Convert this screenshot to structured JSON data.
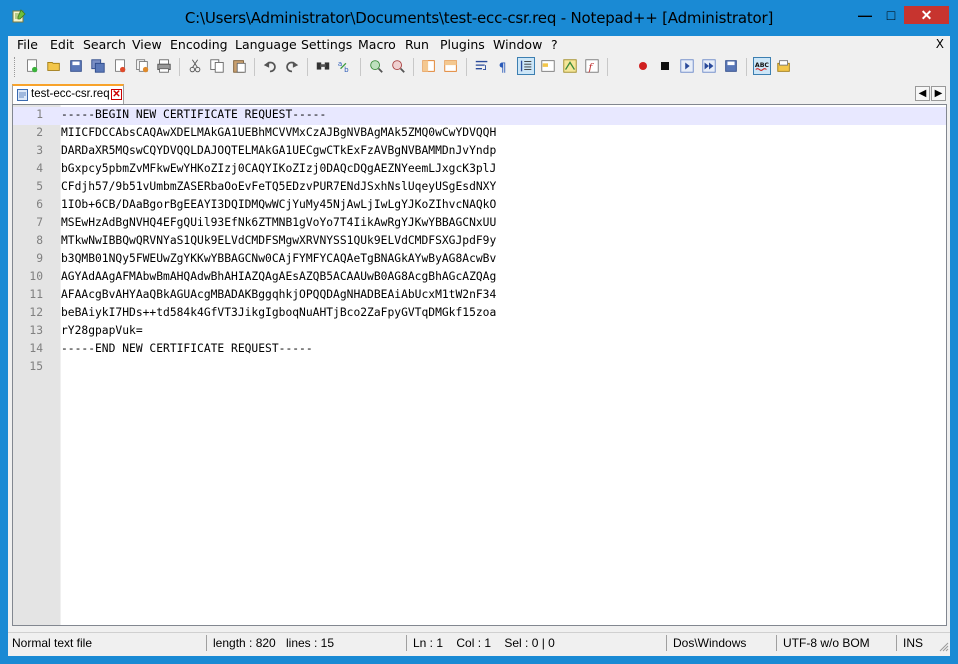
{
  "window": {
    "title": "C:\\Users\\Administrator\\Documents\\test-ecc-csr.req - Notepad++ [Administrator]",
    "minimize_glyph": "—",
    "maximize_glyph": "□",
    "close_glyph": "✕"
  },
  "menu": {
    "items": [
      "File",
      "Edit",
      "Search",
      "View",
      "Encoding",
      "Language",
      "Settings",
      "Macro",
      "Run",
      "Plugins",
      "Window",
      "?"
    ],
    "close_label": "X"
  },
  "toolbar": {
    "icons": [
      "new-file-icon",
      "open-file-icon",
      "save-icon",
      "save-all-icon",
      "close-file-icon",
      "close-all-icon",
      "print-icon",
      "cut-icon",
      "copy-icon",
      "paste-icon",
      "undo-icon",
      "redo-icon",
      "find-icon",
      "replace-icon",
      "zoom-in-icon",
      "zoom-out-icon",
      "sync-vertical-icon",
      "sync-horizontal-icon",
      "word-wrap-icon",
      "show-all-characters-icon",
      "indent-guide-icon",
      "folder-as-workspace-icon",
      "document-map-icon",
      "function-list-icon",
      "record-macro-icon",
      "stop-record-icon",
      "playback-macro-icon",
      "run-macro-multiple-icon",
      "save-macro-icon",
      "spell-check-icon",
      "spell-check-settings-icon"
    ]
  },
  "tabs": {
    "active_label": "test-ecc-csr.req",
    "close_glyph": "✕",
    "scroll_left": "◀",
    "scroll_right": "▶"
  },
  "editor": {
    "current_line": 1,
    "lines": [
      "-----BEGIN NEW CERTIFICATE REQUEST-----",
      "MIICFDCCAbsCAQAwXDELMAkGA1UEBhMCVVMxCzAJBgNVBAgMAk5ZMQ0wCwYDVQQH",
      "DARDaXR5MQswCQYDVQQLDAJOQTELMAkGA1UECgwCTkExFzAVBgNVBAMMDnJvYndp",
      "bGxpcy5pbmZvMFkwEwYHKoZIzj0CAQYIKoZIzj0DAQcDQgAEZNYeemLJxgcK3plJ",
      "CFdjh57/9b51vUmbmZASERbaOoEvFeTQ5EDzvPUR7ENdJSxhNslUqeyUSgEsdNXY",
      "1IOb+6CB/DAaBgorBgEEAYI3DQIDMQwWCjYuMy45NjAwLjIwLgYJKoZIhvcNAQkO",
      "MSEwHzAdBgNVHQ4EFgQUil93EfNk6ZTMNB1gVoYo7T4IikAwRgYJKwYBBAGCNxUU",
      "MTkwNwIBBQwQRVNYaS1QUk9ELVdCMDFSMgwXRVNYSS1QUk9ELVdCMDFSXGJpdF9y",
      "b3QMB01NQy5FWEUwZgYKKwYBBAGCNw0CAjFYMFYCAQAeTgBNAGkAYwByAG8AcwBv",
      "AGYAdAAgAFMAbwBmAHQAdwBhAHIAZQAgAEsAZQB5ACAAUwB0AG8AcgBhAGcAZQAg",
      "AFAAcgBvAHYAaQBkAGUAcgMBADAKBggqhkjOPQQDAgNHADBEAiAbUcxM1tW2nF34",
      "beBAiykI7HDs++td584k4GfVT3JikgIgboqNuAHTjBco2ZaFpyGVTqDMGkf15zoa",
      "rY28gpapVuk=",
      "-----END NEW CERTIFICATE REQUEST-----",
      ""
    ]
  },
  "status": {
    "file_type": "Normal text file",
    "length": "length : 820",
    "lines": "lines : 15",
    "position": "Ln : 1    Col : 1    Sel : 0 | 0",
    "eol": "Dos\\Windows",
    "encoding": "UTF-8 w/o BOM",
    "mode": "INS"
  }
}
